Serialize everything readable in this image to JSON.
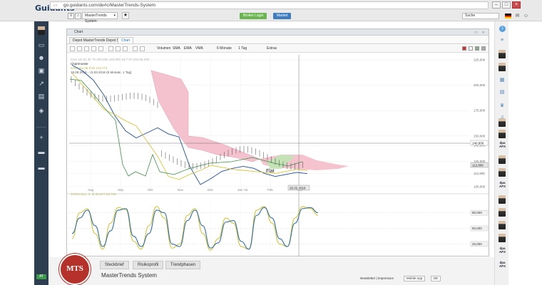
{
  "browser": {
    "url": "go.guidants.com/de#c/MasterTrends-System",
    "logo": "Guidants",
    "logo_accent": "s"
  },
  "apptop": {
    "system_select": "MasterTrends System",
    "broker_login": "Broker Login",
    "market": "Market",
    "search_placeholder": "Suche"
  },
  "window": {
    "title": "Chart",
    "tabs": [
      "Depot MasterTrends Depot Stell",
      "Chart"
    ],
    "toolbar": {
      "volume": "Volumen",
      "sma": "SMA",
      "ema": "EMA",
      "vma": "VMA",
      "period": "6 Monate",
      "interval": "1 Tag",
      "extras": "Extras"
    }
  },
  "legend": {
    "instrument_line": "Kurs 1D 51 35 75 190,095 193,900 19,7 97,016 55,035",
    "pattern": "Chartmuster",
    "ichimoku": "Ichimoku 26 9 52 122,771",
    "range": "18.09.2015 - 15.03.2016 (6 Monate, 1 Tag)",
    "stoch": "STOCH(14, 3, 5) 80,677 86,738"
  },
  "chart_data": [
    {
      "type": "line",
      "title": "",
      "x": [
        "Aug",
        "Sep",
        "Okt",
        "Nov",
        "Dez",
        "Jan '16",
        "Feb",
        "Mrz"
      ],
      "y_ticks": [
        100000,
        112800,
        125000,
        140600,
        150000,
        175000,
        200000,
        225000
      ],
      "y_tick_labels": [
        "100,000",
        "112,800",
        "125,000",
        "140,600",
        "150,000",
        "175,000",
        "200,000",
        "225,000"
      ],
      "ylim": [
        95000,
        230000
      ],
      "price_badges": [
        "140,600",
        "112,800"
      ],
      "annotation": "Flat",
      "date_marker": "25.02.2016",
      "series": [
        {
          "values": [
            220000,
            214000,
            205000,
            190000,
            170000,
            155000,
            148000,
            153000,
            158000,
            152000,
            149000,
            120000,
            102000,
            108000,
            115000,
            118000,
            120000,
            118000,
            113000,
            110000,
            112000,
            114000,
            112800
          ]
        },
        {
          "values": [
            212000,
            200000,
            188000,
            176000,
            171000,
            165000,
            160000,
            145000,
            130000,
            110000,
            107000,
            112000,
            116000,
            121000,
            119000,
            117000,
            116000,
            115000,
            114000,
            113000,
            115000,
            117000,
            116000
          ]
        }
      ]
    },
    {
      "type": "line",
      "title": "",
      "x": [
        "Aug",
        "Sep",
        "Okt",
        "Nov",
        "Dez",
        "Jan '16",
        "Feb",
        "Mrz"
      ],
      "y_ticks": [
        20,
        50,
        80
      ],
      "y_tick_labels": [
        "20,000",
        "50,000",
        "80,000"
      ],
      "ylim": [
        0,
        100
      ],
      "series": [
        {
          "values": [
            30,
            80,
            88,
            40,
            10,
            60,
            90,
            86,
            25,
            10,
            55,
            92,
            70,
            12,
            20,
            75,
            88,
            40,
            8,
            30,
            70,
            60,
            15,
            10,
            85,
            92,
            60,
            20,
            15,
            70,
            92,
            88,
            75
          ]
        },
        {
          "values": [
            40,
            70,
            85,
            55,
            15,
            45,
            85,
            88,
            35,
            15,
            40,
            85,
            80,
            20,
            15,
            65,
            85,
            55,
            12,
            22,
            62,
            65,
            25,
            10,
            75,
            90,
            70,
            30,
            15,
            60,
            88,
            90,
            80
          ]
        }
      ]
    }
  ],
  "bottom": {
    "logo_text": "MTS",
    "tabs": [
      "Steckbrief",
      "Risikoprofil",
      "Trendphasen"
    ],
    "system_name": "MasterTrends System",
    "links": "Newsletter | Impressum",
    "mobile": "Mobile App",
    "lang": "DE"
  },
  "sidebar": {
    "badge": "AT"
  },
  "rightbar": {
    "dpa_label": "dpa AFX"
  }
}
